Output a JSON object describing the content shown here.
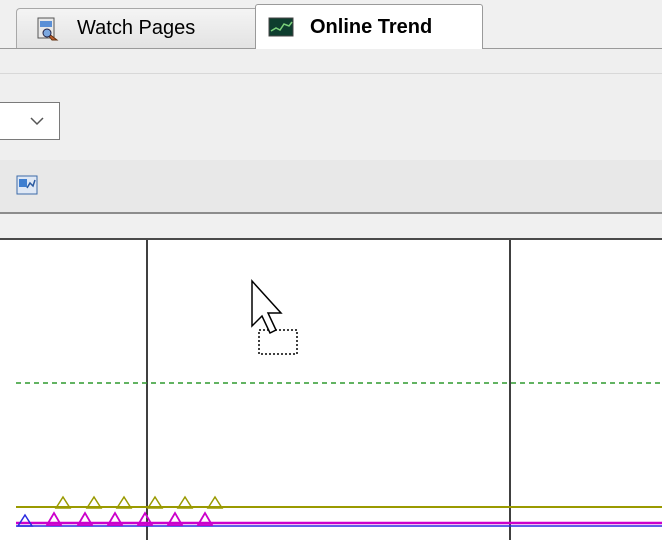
{
  "tabs": [
    {
      "label": "Watch Pages",
      "icon": "watch-pages-icon",
      "active": false
    },
    {
      "label": "Online Trend",
      "icon": "online-trend-icon",
      "active": true
    }
  ],
  "colors": {
    "grid_line": "#000000",
    "dashed_line": "#2e9a2e",
    "olive_series": "#9a9a00",
    "magenta_series": "#cc00cc",
    "blue_series": "#2a2ae0"
  }
}
